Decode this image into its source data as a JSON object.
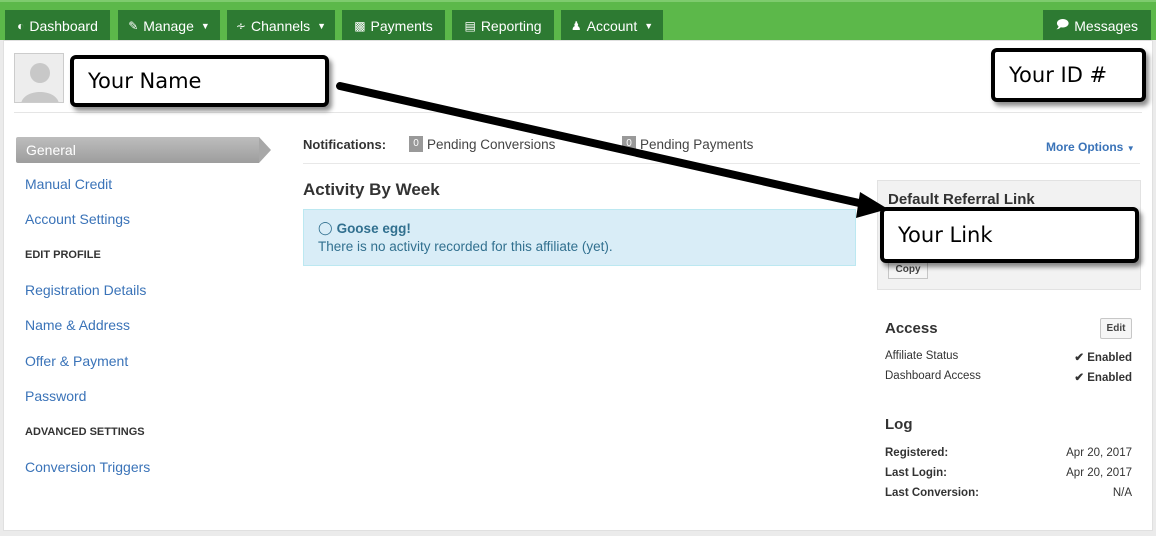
{
  "nav": {
    "dashboard": "Dashboard",
    "manage": "Manage",
    "channels": "Channels",
    "payments": "Payments",
    "reporting": "Reporting",
    "account": "Account",
    "messages": "Messages"
  },
  "callouts": {
    "name": "Your Name",
    "id": "Your ID #",
    "link": "Your Link"
  },
  "sidebar": {
    "general": "General",
    "manual_credit": "Manual Credit",
    "account_settings": "Account Settings",
    "edit_profile_header": "EDIT PROFILE",
    "registration_details": "Registration Details",
    "name_address": "Name & Address",
    "offer_payment": "Offer & Payment",
    "password": "Password",
    "advanced_settings_header": "ADVANCED SETTINGS",
    "conversion_triggers": "Conversion Triggers"
  },
  "notifications": {
    "label": "Notifications:",
    "pending_conversions_count": "0",
    "pending_conversions": "Pending Conversions",
    "pending_payments_count": "0",
    "pending_payments": "Pending Payments",
    "more_options": "More Options"
  },
  "activity": {
    "title": "Activity By Week",
    "alert_title": "Goose egg!",
    "alert_text": "There is no activity recorded for this affiliate (yet)."
  },
  "referral": {
    "title": "Default Referral Link",
    "copy": "Copy"
  },
  "access": {
    "title": "Access",
    "edit": "Edit",
    "affiliate_status_label": "Affiliate Status",
    "affiliate_status_value": "Enabled",
    "dashboard_access_label": "Dashboard Access",
    "dashboard_access_value": "Enabled"
  },
  "log": {
    "title": "Log",
    "registered_label": "Registered:",
    "registered_value": "Apr 20, 2017",
    "last_login_label": "Last Login:",
    "last_login_value": "Apr 20, 2017",
    "last_conversion_label": "Last Conversion:",
    "last_conversion_value": "N/A"
  },
  "colors": {
    "nav_bar": "#5cb84a",
    "nav_button": "#2d7a32",
    "link": "#3a73b8",
    "alert_bg": "#d9edf7"
  }
}
